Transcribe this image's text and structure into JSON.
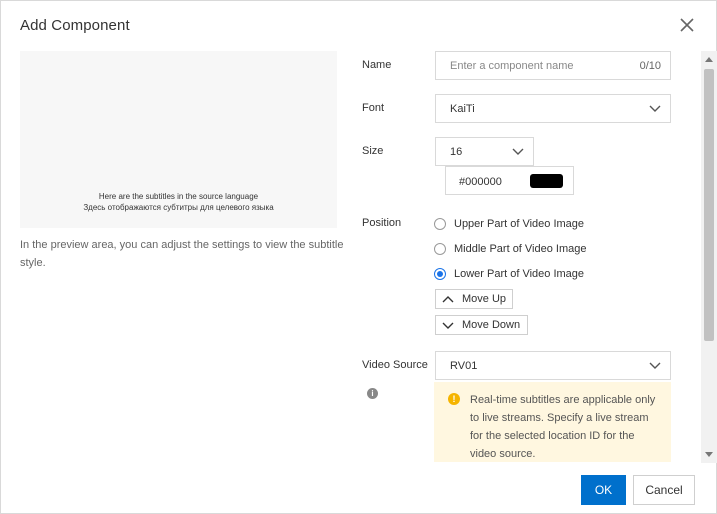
{
  "dialog": {
    "title": "Add Component",
    "close_icon": "close-icon"
  },
  "preview": {
    "subtitle_source": "Here are the subtitles in the source language",
    "subtitle_target": "Здесь отображаются субтитры для целевого языка",
    "hint": "In the preview area, you can adjust the settings to view the subtitle style."
  },
  "form": {
    "name": {
      "label": "Name",
      "placeholder": "Enter a component name",
      "value": "",
      "counter": "0/10"
    },
    "font": {
      "label": "Font",
      "value": "KaiTi"
    },
    "size": {
      "label": "Size",
      "value": "16",
      "color_value": "#000000",
      "color_swatch": "#000000"
    },
    "position": {
      "label": "Position",
      "options": [
        {
          "label": "Upper Part of Video Image",
          "checked": false
        },
        {
          "label": "Middle Part of Video Image",
          "checked": false
        },
        {
          "label": "Lower Part of Video Image",
          "checked": true
        }
      ],
      "move_up": "Move Up",
      "move_down": "Move Down"
    },
    "video_source": {
      "label": "Video Source",
      "value": "RV01",
      "info_icon": "info-icon",
      "notice": "Real-time subtitles are applicable only to live streams. Specify a live stream for the selected location ID for the video source.",
      "notice_icon": "warning-icon"
    }
  },
  "footer": {
    "ok": "OK",
    "cancel": "Cancel"
  },
  "colors": {
    "primary": "#0070cc",
    "radio_checked": "#1a73e8",
    "notice_bg": "#fff7e0",
    "notice_icon": "#f5b400"
  }
}
